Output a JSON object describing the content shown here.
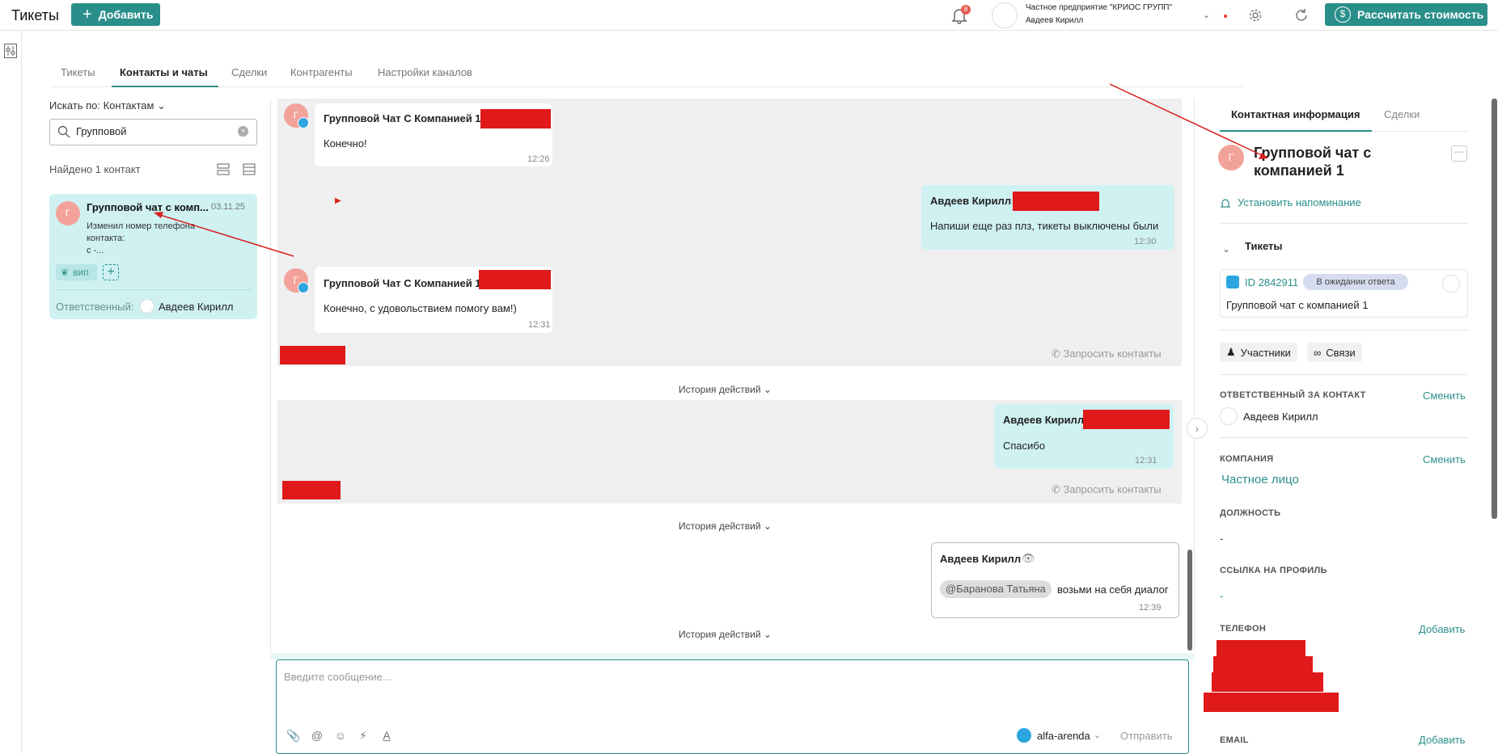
{
  "header": {
    "title": "Тикеты",
    "add_label": "Добавить",
    "notifications_count": "8",
    "org_name": "Частное предприятие \"КРИОС ГРУПП\"",
    "org_user": "Авдеев Кирилл",
    "calc_label": "Рассчитать стоимость"
  },
  "tabs": [
    "Тикеты",
    "Контакты и чаты",
    "Сделки",
    "Контрагенты",
    "Настройки каналов"
  ],
  "contacts": {
    "search_by": "Искать по: Контактам",
    "search_value": "Групповой",
    "found": "Найдено 1 контакт",
    "card": {
      "avatar": "Г",
      "name": "Групповой чат с комп...",
      "date": "03.11.25",
      "msg_line1": "Изменил номер телефона",
      "msg_line2": "контакта:",
      "msg_line3": "с -...",
      "tag": "вип",
      "responsible_label": "Ответственный:",
      "responsible_name": "Авдеев Кирилл"
    }
  },
  "chat": {
    "messages": [
      {
        "sender": "Групповой Чат С Компанией 1",
        "text": "Конечно!",
        "time": "12:26"
      },
      {
        "sender": "Авдеев Кирилл",
        "text": "Напиши еще раз плз, тикеты выключены были",
        "time": "12:30"
      },
      {
        "sender": "Групповой Чат С Компанией 1",
        "text": "Конечно, с удовольствием помогу вам!)",
        "time": "12:31"
      },
      {
        "sender": "Авдеев Кирилл",
        "text": "Спасибо",
        "time": "12:31"
      },
      {
        "sender": "Авдеев Кирилл",
        "mention": "@Баранова Татьяна",
        "text": "возьми на себя диалог",
        "time": "12:39"
      }
    ],
    "avatar": "Г",
    "request_contacts": "Запросить контакты",
    "history": "История действий",
    "composer_placeholder": "Введите сообщение...",
    "channel": "alfa-arenda",
    "send": "Отправить"
  },
  "right": {
    "tab_contact": "Контактная информация",
    "tab_deals": "Сделки",
    "avatar": "Г",
    "name": "Групповой чат с компанией 1",
    "reminder": "Установить напоминание",
    "tickets_title": "Тикеты",
    "ticket_id": "ID 2842911",
    "ticket_status": "В ожидании ответа",
    "ticket_title": "Групповой чат с компанией 1",
    "participants": "Участники",
    "links": "Связи",
    "resp_label": "ОТВЕТСТВЕННЫЙ ЗА КОНТАКТ",
    "change": "Сменить",
    "resp_name": "Авдеев Кирилл",
    "company_label": "КОМПАНИЯ",
    "company_value": "Частное лицо",
    "position_label": "ДОЛЖНОСТЬ",
    "position_value": "-",
    "profile_label": "ССЫЛКА НА ПРОФИЛЬ",
    "profile_value": "-",
    "phone_label": "ТЕЛЕФОН",
    "add": "Добавить",
    "email_label": "EMAIL"
  },
  "colors": {
    "accent": "#2a8f8a",
    "redaction": "#e01a1a",
    "annotation": "#d92020"
  }
}
